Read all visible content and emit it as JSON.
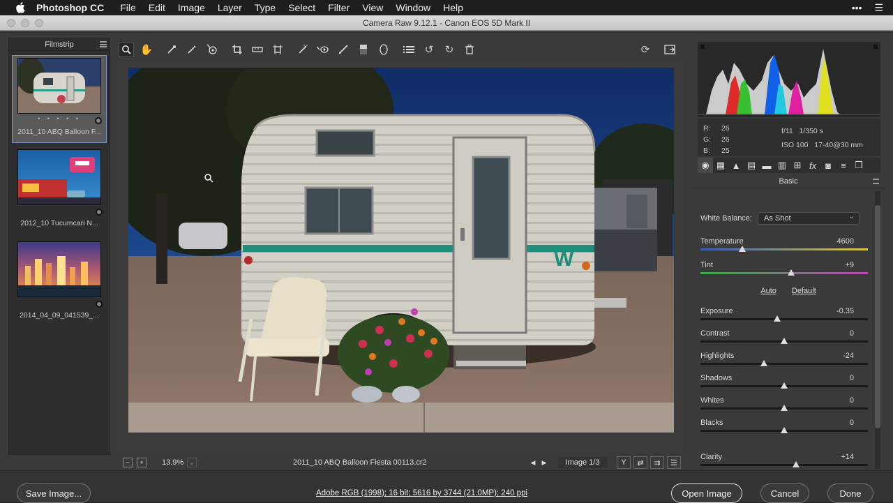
{
  "menubar": {
    "app": "Photoshop CC",
    "menus": [
      "File",
      "Edit",
      "Image",
      "Layer",
      "Type",
      "Select",
      "Filter",
      "View",
      "Window",
      "Help"
    ]
  },
  "window": {
    "title": "Camera Raw 9.12.1  -  Canon EOS 5D Mark II"
  },
  "filmstrip": {
    "title": "Filmstrip",
    "items": [
      {
        "label": "2011_10 ABQ Balloon F...",
        "rating_dots": "• • • • •"
      },
      {
        "label": "2012_10 Tucumcari N...",
        "rating_dots": ""
      },
      {
        "label": "2014_04_09_041539_...",
        "rating_dots": ""
      }
    ]
  },
  "preview": {
    "zoom_out": "−",
    "zoom_in": "+",
    "zoom": "13.9%",
    "filename": "2011_10 ABQ Balloon Fiesta 00113.cr2",
    "image_count": "Image 1/3",
    "before_after": "Y"
  },
  "info": {
    "r_label": "R:",
    "r": "26",
    "g_label": "G:",
    "g": "26",
    "b_label": "B:",
    "b": "25",
    "aperture": "f/11",
    "shutter": "1/350 s",
    "iso": "ISO 100",
    "lens": "17-40@30 mm"
  },
  "panel": {
    "title": "Basic",
    "white_balance_label": "White Balance:",
    "white_balance_value": "As Shot",
    "auto": "Auto",
    "default": "Default",
    "sliders": [
      {
        "label": "Temperature",
        "value": "4600",
        "pos": 0.25
      },
      {
        "label": "Tint",
        "value": "+9",
        "pos": 0.54
      },
      {
        "label": "Exposure",
        "value": "-0.35",
        "pos": 0.46
      },
      {
        "label": "Contrast",
        "value": "0",
        "pos": 0.5
      },
      {
        "label": "Highlights",
        "value": "-24",
        "pos": 0.38
      },
      {
        "label": "Shadows",
        "value": "0",
        "pos": 0.5
      },
      {
        "label": "Whites",
        "value": "0",
        "pos": 0.5
      },
      {
        "label": "Blacks",
        "value": "0",
        "pos": 0.5
      },
      {
        "label": "Clarity",
        "value": "+14",
        "pos": 0.57
      }
    ]
  },
  "bottom": {
    "save": "Save Image...",
    "workflow": "Adobe RGB (1998); 16 bit; 5616 by 3744 (21.0MP); 240 ppi",
    "open": "Open Image",
    "cancel": "Cancel",
    "done": "Done"
  },
  "colors": {
    "accent_selection": "#7d95c8",
    "panel_bg": "#3a3a3a"
  }
}
